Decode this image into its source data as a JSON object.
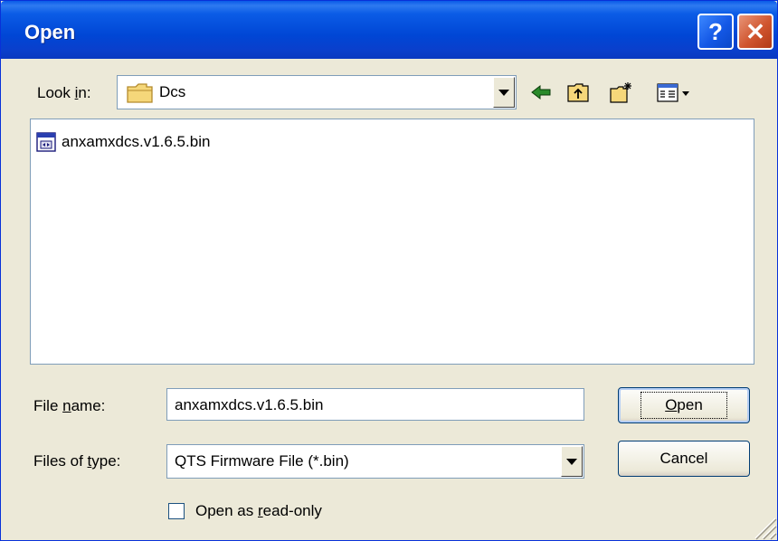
{
  "window": {
    "title": "Open"
  },
  "titlebar": {
    "help_label": "?",
    "close_label": "✕"
  },
  "lookin": {
    "label_pre": "Look ",
    "label_key": "i",
    "label_post": "n:",
    "value": "Dcs"
  },
  "files": [
    {
      "name": "anxamxdcs.v1.6.5.bin"
    }
  ],
  "filename": {
    "label_pre": "File ",
    "label_key": "n",
    "label_post": "ame:",
    "value": "anxamxdcs.v1.6.5.bin"
  },
  "filetype": {
    "label_pre": "Files of ",
    "label_key": "t",
    "label_post": "ype:",
    "value": "QTS Firmware File (*.bin)"
  },
  "buttons": {
    "open_key": "O",
    "open_rest": "pen",
    "cancel": "Cancel"
  },
  "readonly": {
    "label_pre": "Open as ",
    "label_key": "r",
    "label_post": "ead-only",
    "checked": false
  },
  "icons": {
    "back": "back-arrow-icon",
    "up": "up-folder-icon",
    "new_folder": "new-folder-icon",
    "view_menu": "view-menu-icon",
    "folder": "folder-icon",
    "file": "bin-file-icon"
  },
  "colors": {
    "titlebar": "#0054e3",
    "dialog_bg": "#ece9d8",
    "close_button": "#d0552f",
    "help_button": "#1458e6"
  }
}
